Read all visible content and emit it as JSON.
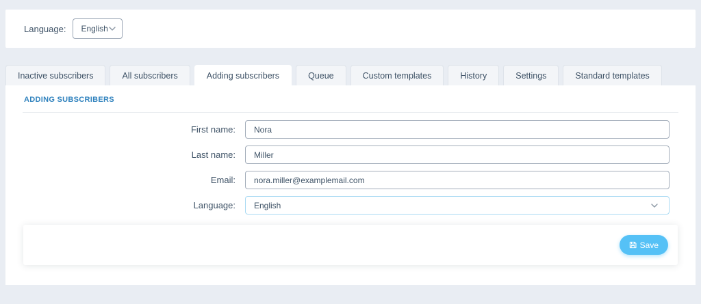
{
  "colors": {
    "page_background": "#e9edf3",
    "heading_blue": "#2e81bd",
    "save_button_blue": "#55c1f6",
    "select_border_blue": "#a9daf3",
    "text": "#3e5266"
  },
  "top_bar": {
    "label": "Language:",
    "value": "English"
  },
  "tabs": [
    {
      "label": "Inactive subscribers",
      "active": false
    },
    {
      "label": "All subscribers",
      "active": false
    },
    {
      "label": "Adding subscribers",
      "active": true
    },
    {
      "label": "Queue",
      "active": false
    },
    {
      "label": "Custom templates",
      "active": false
    },
    {
      "label": "History",
      "active": false
    },
    {
      "label": "Settings",
      "active": false
    },
    {
      "label": "Standard templates",
      "active": false
    }
  ],
  "panel": {
    "heading": "ADDING SUBSCRIBERS",
    "fields": [
      {
        "label": "First name:",
        "value": "Nora",
        "type": "text"
      },
      {
        "label": "Last name:",
        "value": "Miller",
        "type": "text"
      },
      {
        "label": "Email:",
        "value": "nora.miller@examplemail.com",
        "type": "text"
      },
      {
        "label": "Language:",
        "value": "English",
        "type": "select"
      }
    ],
    "save_button": {
      "label": "Save",
      "icon": "save-icon"
    }
  }
}
